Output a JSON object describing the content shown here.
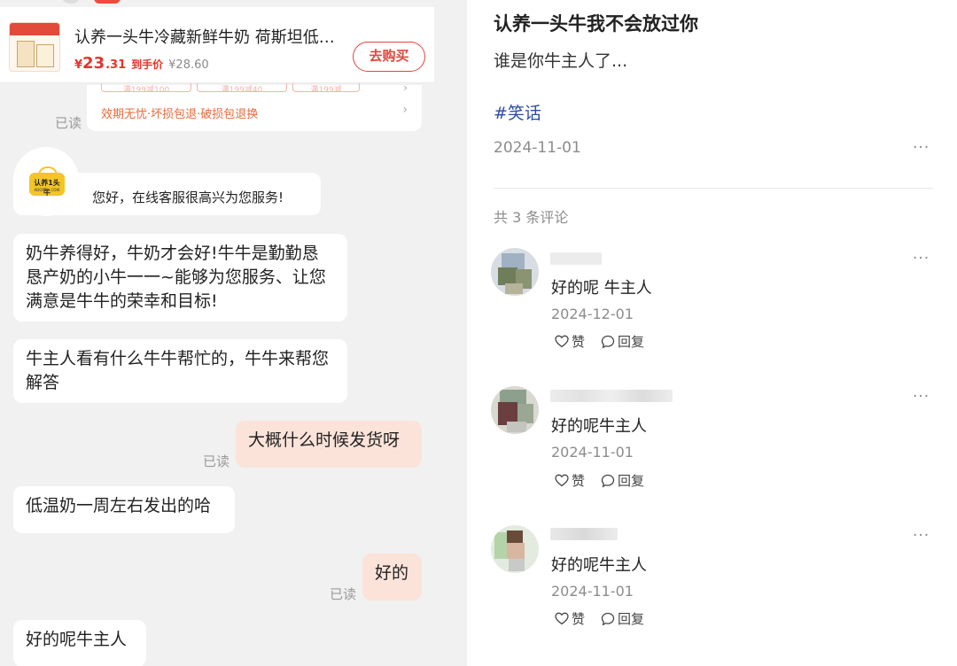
{
  "chat": {
    "product": {
      "title": "认养一头牛冷藏新鲜牛奶  荷斯坦低…",
      "price_symbol": "¥",
      "price_int": "23",
      "price_dec": ".31",
      "price_tag": "到手价",
      "original_price": "¥28.60",
      "buy_label": "去购买"
    },
    "coupons": [
      "满199减100",
      "满199减40",
      "满199减"
    ],
    "guarantee": "效期无忧·坏损包退·破损包退换",
    "read_label": "已读",
    "greeting": "您好，在线客服很高兴为您服务!",
    "logo_text": "认养1头牛",
    "logo_sub": "ADOPT A COW",
    "messages": {
      "m1": "奶牛养得好，牛奶才会好!牛牛是勤勤恳恳产奶的小牛一一~能够为您服务、让您满意是牛牛的荣幸和目标!",
      "m2": "牛主人看有什么牛牛帮忙的，牛牛来帮您解答",
      "m3": "大概什么时候发货呀",
      "m4": "低温奶一周左右发出的哈",
      "m5": "好的",
      "m6": "好的呢牛主人"
    }
  },
  "post": {
    "title": "认养一头牛我不会放过你",
    "body": "谁是你牛主人了...",
    "tag": "#笑话",
    "date": "2024-11-01",
    "more_label": "···",
    "comment_count": "共 3 条评论",
    "comments": [
      {
        "text": "好的呢 牛主人",
        "date": "2024-12-01",
        "like_label": "赞",
        "reply_label": "回复"
      },
      {
        "text": "好的呢牛主人",
        "date": "2024-11-01",
        "like_label": "赞",
        "reply_label": "回复"
      },
      {
        "text": "好的呢牛主人",
        "date": "2024-11-01",
        "like_label": "赞",
        "reply_label": "回复"
      }
    ]
  }
}
